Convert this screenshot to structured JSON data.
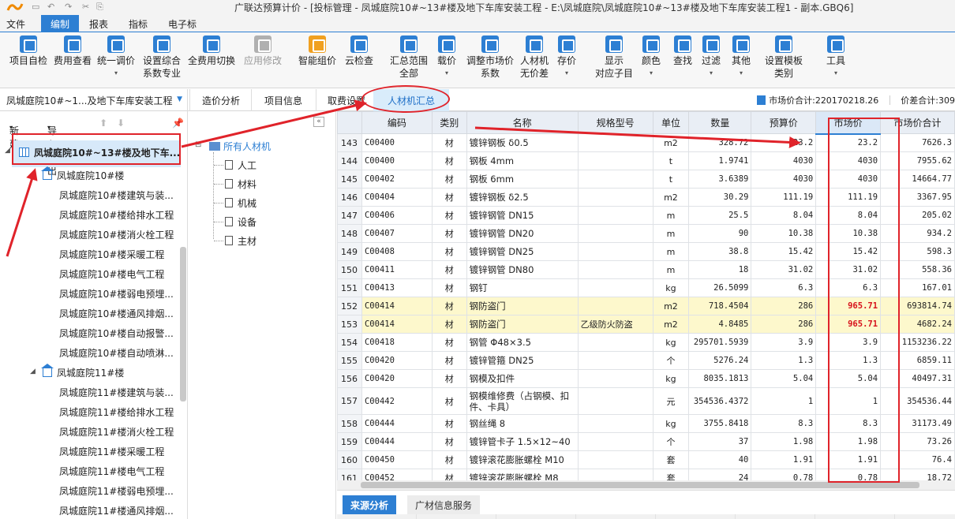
{
  "window": {
    "title": "广联达预算计价 - [投标管理 - 凤城庭院10#~13#楼及地下车库安装工程 - E:\\凤城庭院\\凤城庭院10#~13#楼及地下车库安装工程1 - 副本.GBQ6]"
  },
  "menu": [
    "文件",
    "编制",
    "报表",
    "指标",
    "电子标"
  ],
  "menu_active": "编制",
  "ribbon": [
    {
      "label": "项目自检",
      "icon": "check-icon",
      "color": "#2d7fd3"
    },
    {
      "label": "费用查看",
      "icon": "fee-view-icon",
      "color": "#2d7fd3"
    },
    {
      "label": "统一调价",
      "icon": "price-adjust-icon",
      "color": "#2d7fd3",
      "dropdown": true
    },
    {
      "label": "设置综合",
      "label2": "系数专业",
      "icon": "settings-icon",
      "color": "#2d7fd3"
    },
    {
      "label": "全费用切换",
      "icon": "switch-icon",
      "color": "#2d7fd3"
    },
    {
      "label": "应用修改",
      "icon": "apply-icon",
      "color": "#b0b0b0",
      "disabled": true
    },
    {
      "label": "智能组价",
      "icon": "smart-price-icon",
      "color": "#f0a020"
    },
    {
      "label": "云检查",
      "icon": "cloud-check-icon",
      "color": "#2d7fd3"
    },
    {
      "label": "汇总范围",
      "label2": "全部",
      "icon": "summary-icon",
      "color": "#2d7fd3"
    },
    {
      "label": "载价",
      "icon": "load-price-icon",
      "color": "#2d7fd3",
      "dropdown": true
    },
    {
      "label": "调整市场价",
      "label2": "系数",
      "icon": "market-adjust-icon",
      "color": "#2d7fd3"
    },
    {
      "label": "人材机",
      "label2": "无价差",
      "icon": "scale-icon",
      "color": "#2d7fd3"
    },
    {
      "label": "存价",
      "icon": "save-price-icon",
      "color": "#2d7fd3",
      "dropdown": true
    },
    {
      "label": "显示",
      "label2": "对应子目",
      "icon": "display-icon",
      "color": "#2d7fd3"
    },
    {
      "label": "颜色",
      "icon": "color-icon",
      "color": "#2d7fd3",
      "dropdown": true
    },
    {
      "label": "查找",
      "icon": "binoculars-icon",
      "color": "#2d7fd3"
    },
    {
      "label": "过滤",
      "icon": "filter-icon",
      "color": "#2d7fd3",
      "dropdown": true
    },
    {
      "label": "其他",
      "icon": "other-icon",
      "color": "#2d7fd3",
      "dropdown": true
    },
    {
      "label": "设置模板",
      "label2": "类别",
      "icon": "template-icon",
      "color": "#2d7fd3"
    },
    {
      "label": "工具",
      "icon": "tool-icon",
      "color": "#2d7fd3",
      "dropdown": true
    }
  ],
  "project_select": "凤城庭院10#~1...及地下车库安装工程",
  "tabs": [
    "造价分析",
    "项目信息",
    "取费设置",
    "人材机汇总"
  ],
  "active_tab": "人材机汇总",
  "status": {
    "market_total_label": "市场价合计:220170218.26",
    "diff_total_label": "价差合计:309"
  },
  "left": {
    "new_label": "新建",
    "import_label": "导入导出",
    "root": "凤城庭院10#~13#楼及地下车...",
    "groups": [
      {
        "name": "凤城庭院10#楼",
        "children": [
          "凤城庭院10#楼建筑与装...",
          "凤城庭院10#楼给排水工程",
          "凤城庭院10#楼消火栓工程",
          "凤城庭院10#楼采暖工程",
          "凤城庭院10#楼电气工程",
          "凤城庭院10#楼弱电预埋...",
          "凤城庭院10#楼通风排烟...",
          "凤城庭院10#楼自动报警...",
          "凤城庭院10#楼自动喷淋..."
        ]
      },
      {
        "name": "凤城庭院11#楼",
        "children": [
          "凤城庭院11#楼建筑与装...",
          "凤城庭院11#楼给排水工程",
          "凤城庭院11#楼消火栓工程",
          "凤城庭院11#楼采暖工程",
          "凤城庭院11#楼电气工程",
          "凤城庭院11#楼弱电预埋...",
          "凤城庭院11#楼通风排烟..."
        ]
      }
    ]
  },
  "categories": {
    "root": "所有人材机",
    "items": [
      "人工",
      "材料",
      "机械",
      "设备",
      "主材"
    ]
  },
  "grid": {
    "headers": [
      "编码",
      "类别",
      "名称",
      "规格型号",
      "单位",
      "数量",
      "预算价",
      "市场价",
      "市场价合计"
    ],
    "rows": [
      {
        "n": "143",
        "code": "C00400",
        "type": "材",
        "name": "镀锌钢板 δ0.5",
        "spec": "",
        "unit": "m2",
        "qty": "328.72",
        "budget": "23.2",
        "market": "23.2",
        "total": "7626.3"
      },
      {
        "n": "144",
        "code": "C00400",
        "type": "材",
        "name": "钢板 4mm",
        "spec": "",
        "unit": "t",
        "qty": "1.9741",
        "budget": "4030",
        "market": "4030",
        "total": "7955.62"
      },
      {
        "n": "145",
        "code": "C00402",
        "type": "材",
        "name": "钢板 6mm",
        "spec": "",
        "unit": "t",
        "qty": "3.6389",
        "budget": "4030",
        "market": "4030",
        "total": "14664.77"
      },
      {
        "n": "146",
        "code": "C00404",
        "type": "材",
        "name": "镀锌钢板 δ2.5",
        "spec": "",
        "unit": "m2",
        "qty": "30.29",
        "budget": "111.19",
        "market": "111.19",
        "total": "3367.95"
      },
      {
        "n": "147",
        "code": "C00406",
        "type": "材",
        "name": "镀锌钢管 DN15",
        "spec": "",
        "unit": "m",
        "qty": "25.5",
        "budget": "8.04",
        "market": "8.04",
        "total": "205.02"
      },
      {
        "n": "148",
        "code": "C00407",
        "type": "材",
        "name": "镀锌钢管 DN20",
        "spec": "",
        "unit": "m",
        "qty": "90",
        "budget": "10.38",
        "market": "10.38",
        "total": "934.2"
      },
      {
        "n": "149",
        "code": "C00408",
        "type": "材",
        "name": "镀锌钢管 DN25",
        "spec": "",
        "unit": "m",
        "qty": "38.8",
        "budget": "15.42",
        "market": "15.42",
        "total": "598.3"
      },
      {
        "n": "150",
        "code": "C00411",
        "type": "材",
        "name": "镀锌钢管 DN80",
        "spec": "",
        "unit": "m",
        "qty": "18",
        "budget": "31.02",
        "market": "31.02",
        "total": "558.36"
      },
      {
        "n": "151",
        "code": "C00413",
        "type": "材",
        "name": "钢钉",
        "spec": "",
        "unit": "kg",
        "qty": "26.5099",
        "budget": "6.3",
        "market": "6.3",
        "total": "167.01"
      },
      {
        "n": "152",
        "code": "C00414",
        "type": "材",
        "name": "钢防盗门",
        "spec": "",
        "unit": "m2",
        "qty": "718.4504",
        "budget": "286",
        "market": "965.71",
        "total": "693814.74",
        "hl": true
      },
      {
        "n": "153",
        "code": "C00414",
        "type": "材",
        "name": "钢防盗门",
        "spec": "乙级防火防盗",
        "unit": "m2",
        "qty": "4.8485",
        "budget": "286",
        "market": "965.71",
        "total": "4682.24",
        "hl": true
      },
      {
        "n": "154",
        "code": "C00418",
        "type": "材",
        "name": "钢管 Φ48×3.5",
        "spec": "",
        "unit": "kg",
        "qty": "295701.5939",
        "budget": "3.9",
        "market": "3.9",
        "total": "1153236.22"
      },
      {
        "n": "155",
        "code": "C00420",
        "type": "材",
        "name": "镀锌管箍 DN25",
        "spec": "",
        "unit": "个",
        "qty": "5276.24",
        "budget": "1.3",
        "market": "1.3",
        "total": "6859.11"
      },
      {
        "n": "156",
        "code": "C00420",
        "type": "材",
        "name": "钢模及扣件",
        "spec": "",
        "unit": "kg",
        "qty": "8035.1813",
        "budget": "5.04",
        "market": "5.04",
        "total": "40497.31"
      },
      {
        "n": "157",
        "code": "C00442",
        "type": "材",
        "name": "钢模维修费（占钢模、扣件、卡具）",
        "spec": "",
        "unit": "元",
        "qty": "354536.4372",
        "budget": "1",
        "market": "1",
        "total": "354536.44",
        "tall": true
      },
      {
        "n": "158",
        "code": "C00444",
        "type": "材",
        "name": "钢丝绳 8",
        "spec": "",
        "unit": "kg",
        "qty": "3755.8418",
        "budget": "8.3",
        "market": "8.3",
        "total": "31173.49"
      },
      {
        "n": "159",
        "code": "C00444",
        "type": "材",
        "name": "镀锌管卡子 1.5×12~40",
        "spec": "",
        "unit": "个",
        "qty": "37",
        "budget": "1.98",
        "market": "1.98",
        "total": "73.26"
      },
      {
        "n": "160",
        "code": "C00450",
        "type": "材",
        "name": "镀锌滚花膨胀螺栓 M10",
        "spec": "",
        "unit": "套",
        "qty": "40",
        "budget": "1.91",
        "market": "1.91",
        "total": "76.4"
      },
      {
        "n": "161",
        "code": "C00452",
        "type": "材",
        "name": "镀锌滚花膨胀螺栓 M8",
        "spec": "",
        "unit": "套",
        "qty": "24",
        "budget": "0.78",
        "market": "0.78",
        "total": "18.72"
      }
    ]
  },
  "bottom_tabs": [
    "来源分析",
    "广材信息服务"
  ],
  "colors": {
    "accent": "#2d7fd3",
    "annotation": "#e0232a",
    "highlight_row": "#fdf8cc",
    "red_value": "#d7111b"
  }
}
